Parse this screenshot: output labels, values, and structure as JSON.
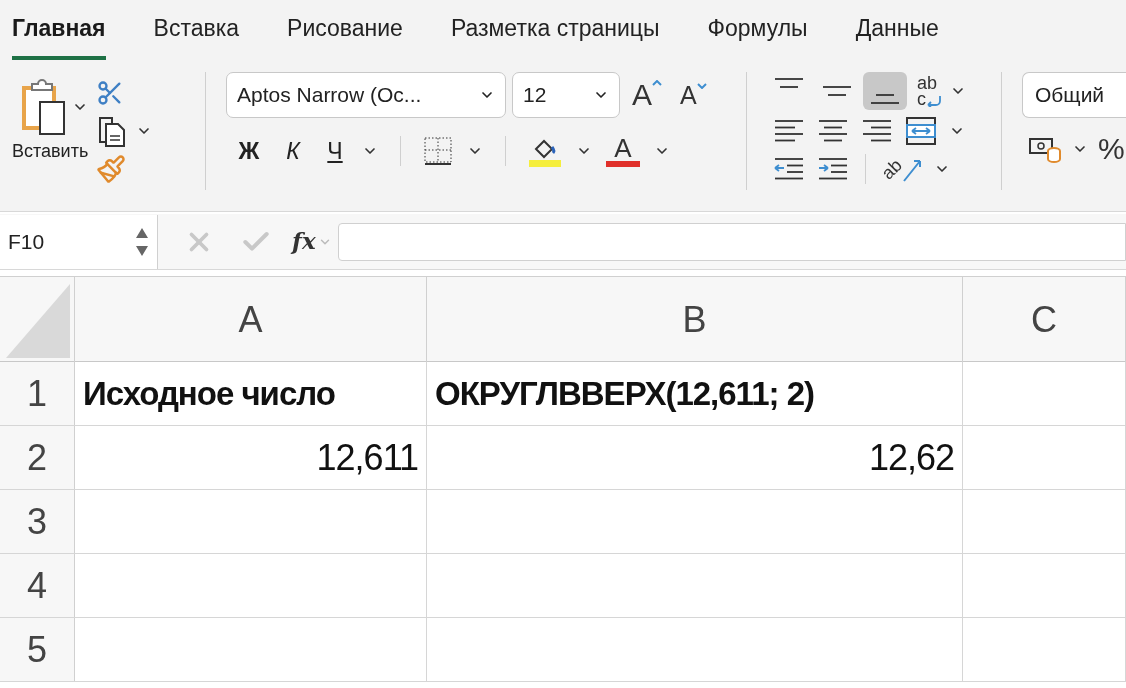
{
  "tabs": [
    {
      "label": "Главная",
      "selected": true
    },
    {
      "label": "Вставка",
      "selected": false
    },
    {
      "label": "Рисование",
      "selected": false
    },
    {
      "label": "Разметка страницы",
      "selected": false
    },
    {
      "label": "Формулы",
      "selected": false
    },
    {
      "label": "Данные",
      "selected": false
    }
  ],
  "clipboard": {
    "paste_label": "Вставить"
  },
  "font": {
    "name": "Aptos Narrow (Ос...",
    "size": "12",
    "grow": "A",
    "shrink": "A",
    "bold": "Ж",
    "italic": "К",
    "underline": "Ч",
    "color_letter": "A"
  },
  "alignment": {
    "vertical": [
      {
        "kind": "top",
        "selected": false
      },
      {
        "kind": "middle",
        "selected": false
      },
      {
        "kind": "bottom",
        "selected": true
      }
    ],
    "wrap_top": "ab",
    "wrap_bottom": "c",
    "orientation": "ab"
  },
  "number": {
    "format": "Общий",
    "percent": "%"
  },
  "formula_bar": {
    "name_box": "F10",
    "fx": "fx"
  },
  "sheet": {
    "columns": [
      "A",
      "B",
      "C"
    ],
    "rows": [
      {
        "number": "1",
        "cells": [
          {
            "text": "Исходное число",
            "kind": "label"
          },
          {
            "text": "ОКРУГЛВВЕРХ(12,611; 2)",
            "kind": "label"
          }
        ]
      },
      {
        "number": "2",
        "cells": [
          {
            "text": "12,611",
            "kind": "number"
          },
          {
            "text": "12,62",
            "kind": "number"
          }
        ]
      },
      {
        "number": "3",
        "cells": []
      },
      {
        "number": "4",
        "cells": []
      },
      {
        "number": "5",
        "cells": []
      }
    ]
  }
}
